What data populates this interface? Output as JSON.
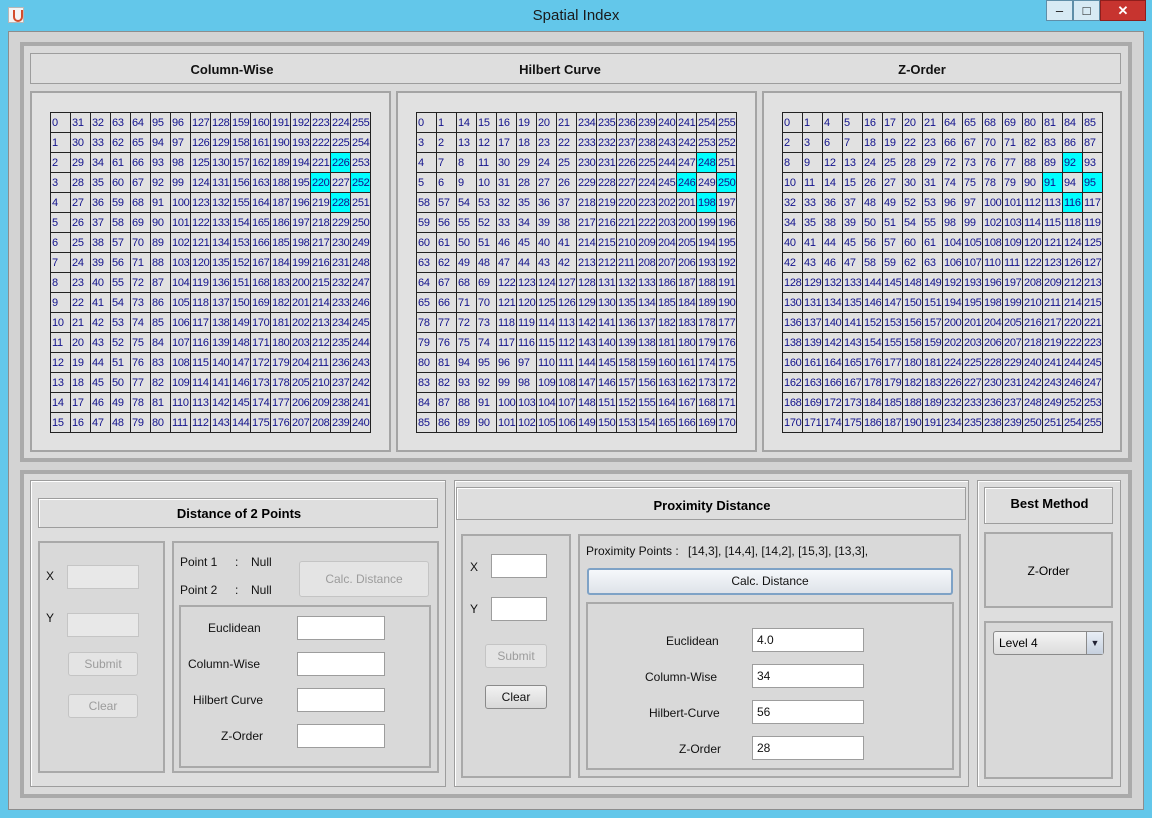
{
  "window": {
    "title": "Spatial Index"
  },
  "grid_headers": {
    "column_wise": "Column-Wise",
    "hilbert": "Hilbert Curve",
    "zorder": "Z-Order"
  },
  "grids": {
    "column_wise": [
      [
        "0",
        "31",
        "32",
        "63",
        "64",
        "95",
        "96",
        "127",
        "128",
        "159",
        "160",
        "191",
        "192",
        "223",
        "224",
        "255"
      ],
      [
        "1",
        "30",
        "33",
        "62",
        "65",
        "94",
        "97",
        "126",
        "129",
        "158",
        "161",
        "190",
        "193",
        "222",
        "225",
        "254"
      ],
      [
        "2",
        "29",
        "34",
        "61",
        "66",
        "93",
        "98",
        "125",
        "130",
        "157",
        "162",
        "189",
        "194",
        "221",
        "226",
        "253"
      ],
      [
        "3",
        "28",
        "35",
        "60",
        "67",
        "92",
        "99",
        "124",
        "131",
        "156",
        "163",
        "188",
        "195",
        "220",
        "227",
        "252"
      ],
      [
        "4",
        "27",
        "36",
        "59",
        "68",
        "91",
        "100",
        "123",
        "132",
        "155",
        "164",
        "187",
        "196",
        "219",
        "228",
        "251"
      ],
      [
        "5",
        "26",
        "37",
        "58",
        "69",
        "90",
        "101",
        "122",
        "133",
        "154",
        "165",
        "186",
        "197",
        "218",
        "229",
        "250"
      ],
      [
        "6",
        "25",
        "38",
        "57",
        "70",
        "89",
        "102",
        "121",
        "134",
        "153",
        "166",
        "185",
        "198",
        "217",
        "230",
        "249"
      ],
      [
        "7",
        "24",
        "39",
        "56",
        "71",
        "88",
        "103",
        "120",
        "135",
        "152",
        "167",
        "184",
        "199",
        "216",
        "231",
        "248"
      ],
      [
        "8",
        "23",
        "40",
        "55",
        "72",
        "87",
        "104",
        "119",
        "136",
        "151",
        "168",
        "183",
        "200",
        "215",
        "232",
        "247"
      ],
      [
        "9",
        "22",
        "41",
        "54",
        "73",
        "86",
        "105",
        "118",
        "137",
        "150",
        "169",
        "182",
        "201",
        "214",
        "233",
        "246"
      ],
      [
        "10",
        "21",
        "42",
        "53",
        "74",
        "85",
        "106",
        "117",
        "138",
        "149",
        "170",
        "181",
        "202",
        "213",
        "234",
        "245"
      ],
      [
        "11",
        "20",
        "43",
        "52",
        "75",
        "84",
        "107",
        "116",
        "139",
        "148",
        "171",
        "180",
        "203",
        "212",
        "235",
        "244"
      ],
      [
        "12",
        "19",
        "44",
        "51",
        "76",
        "83",
        "108",
        "115",
        "140",
        "147",
        "172",
        "179",
        "204",
        "211",
        "236",
        "243"
      ],
      [
        "13",
        "18",
        "45",
        "50",
        "77",
        "82",
        "109",
        "114",
        "141",
        "146",
        "173",
        "178",
        "205",
        "210",
        "237",
        "242"
      ],
      [
        "14",
        "17",
        "46",
        "49",
        "78",
        "81",
        "110",
        "113",
        "142",
        "145",
        "174",
        "177",
        "206",
        "209",
        "238",
        "241"
      ],
      [
        "15",
        "16",
        "47",
        "48",
        "79",
        "80",
        "111",
        "112",
        "143",
        "144",
        "175",
        "176",
        "207",
        "208",
        "239",
        "240"
      ]
    ],
    "hilbert": [
      [
        "0",
        "1",
        "14",
        "15",
        "16",
        "19",
        "20",
        "21",
        "234",
        "235",
        "236",
        "239",
        "240",
        "241",
        "254",
        "255"
      ],
      [
        "3",
        "2",
        "13",
        "12",
        "17",
        "18",
        "23",
        "22",
        "233",
        "232",
        "237",
        "238",
        "243",
        "242",
        "253",
        "252"
      ],
      [
        "4",
        "7",
        "8",
        "11",
        "30",
        "29",
        "24",
        "25",
        "230",
        "231",
        "226",
        "225",
        "244",
        "247",
        "248",
        "251"
      ],
      [
        "5",
        "6",
        "9",
        "10",
        "31",
        "28",
        "27",
        "26",
        "229",
        "228",
        "227",
        "224",
        "245",
        "246",
        "249",
        "250"
      ],
      [
        "58",
        "57",
        "54",
        "53",
        "32",
        "35",
        "36",
        "37",
        "218",
        "219",
        "220",
        "223",
        "202",
        "201",
        "198",
        "197"
      ],
      [
        "59",
        "56",
        "55",
        "52",
        "33",
        "34",
        "39",
        "38",
        "217",
        "216",
        "221",
        "222",
        "203",
        "200",
        "199",
        "196"
      ],
      [
        "60",
        "61",
        "50",
        "51",
        "46",
        "45",
        "40",
        "41",
        "214",
        "215",
        "210",
        "209",
        "204",
        "205",
        "194",
        "195"
      ],
      [
        "63",
        "62",
        "49",
        "48",
        "47",
        "44",
        "43",
        "42",
        "213",
        "212",
        "211",
        "208",
        "207",
        "206",
        "193",
        "192"
      ],
      [
        "64",
        "67",
        "68",
        "69",
        "122",
        "123",
        "124",
        "127",
        "128",
        "131",
        "132",
        "133",
        "186",
        "187",
        "188",
        "191"
      ],
      [
        "65",
        "66",
        "71",
        "70",
        "121",
        "120",
        "125",
        "126",
        "129",
        "130",
        "135",
        "134",
        "185",
        "184",
        "189",
        "190"
      ],
      [
        "78",
        "77",
        "72",
        "73",
        "118",
        "119",
        "114",
        "113",
        "142",
        "141",
        "136",
        "137",
        "182",
        "183",
        "178",
        "177"
      ],
      [
        "79",
        "76",
        "75",
        "74",
        "117",
        "116",
        "115",
        "112",
        "143",
        "140",
        "139",
        "138",
        "181",
        "180",
        "179",
        "176"
      ],
      [
        "80",
        "81",
        "94",
        "95",
        "96",
        "97",
        "110",
        "111",
        "144",
        "145",
        "158",
        "159",
        "160",
        "161",
        "174",
        "175"
      ],
      [
        "83",
        "82",
        "93",
        "92",
        "99",
        "98",
        "109",
        "108",
        "147",
        "146",
        "157",
        "156",
        "163",
        "162",
        "173",
        "172"
      ],
      [
        "84",
        "87",
        "88",
        "91",
        "100",
        "103",
        "104",
        "107",
        "148",
        "151",
        "152",
        "155",
        "164",
        "167",
        "168",
        "171"
      ],
      [
        "85",
        "86",
        "89",
        "90",
        "101",
        "102",
        "105",
        "106",
        "149",
        "150",
        "153",
        "154",
        "165",
        "166",
        "169",
        "170"
      ]
    ],
    "zorder": [
      [
        "0",
        "1",
        "4",
        "5",
        "16",
        "17",
        "20",
        "21",
        "64",
        "65",
        "68",
        "69",
        "80",
        "81",
        "84",
        "85"
      ],
      [
        "2",
        "3",
        "6",
        "7",
        "18",
        "19",
        "22",
        "23",
        "66",
        "67",
        "70",
        "71",
        "82",
        "83",
        "86",
        "87"
      ],
      [
        "8",
        "9",
        "12",
        "13",
        "24",
        "25",
        "28",
        "29",
        "72",
        "73",
        "76",
        "77",
        "88",
        "89",
        "92",
        "93"
      ],
      [
        "10",
        "11",
        "14",
        "15",
        "26",
        "27",
        "30",
        "31",
        "74",
        "75",
        "78",
        "79",
        "90",
        "91",
        "94",
        "95"
      ],
      [
        "32",
        "33",
        "36",
        "37",
        "48",
        "49",
        "52",
        "53",
        "96",
        "97",
        "100",
        "101",
        "112",
        "113",
        "116",
        "117"
      ],
      [
        "34",
        "35",
        "38",
        "39",
        "50",
        "51",
        "54",
        "55",
        "98",
        "99",
        "102",
        "103",
        "114",
        "115",
        "118",
        "119"
      ],
      [
        "40",
        "41",
        "44",
        "45",
        "56",
        "57",
        "60",
        "61",
        "104",
        "105",
        "108",
        "109",
        "120",
        "121",
        "124",
        "125"
      ],
      [
        "42",
        "43",
        "46",
        "47",
        "58",
        "59",
        "62",
        "63",
        "106",
        "107",
        "110",
        "111",
        "122",
        "123",
        "126",
        "127"
      ],
      [
        "128",
        "129",
        "132",
        "133",
        "144",
        "145",
        "148",
        "149",
        "192",
        "193",
        "196",
        "197",
        "208",
        "209",
        "212",
        "213"
      ],
      [
        "130",
        "131",
        "134",
        "135",
        "146",
        "147",
        "150",
        "151",
        "194",
        "195",
        "198",
        "199",
        "210",
        "211",
        "214",
        "215"
      ],
      [
        "136",
        "137",
        "140",
        "141",
        "152",
        "153",
        "156",
        "157",
        "200",
        "201",
        "204",
        "205",
        "216",
        "217",
        "220",
        "221"
      ],
      [
        "138",
        "139",
        "142",
        "143",
        "154",
        "155",
        "158",
        "159",
        "202",
        "203",
        "206",
        "207",
        "218",
        "219",
        "222",
        "223"
      ],
      [
        "160",
        "161",
        "164",
        "165",
        "176",
        "177",
        "180",
        "181",
        "224",
        "225",
        "228",
        "229",
        "240",
        "241",
        "244",
        "245"
      ],
      [
        "162",
        "163",
        "166",
        "167",
        "178",
        "179",
        "182",
        "183",
        "226",
        "227",
        "230",
        "231",
        "242",
        "243",
        "246",
        "247"
      ],
      [
        "168",
        "169",
        "172",
        "173",
        "184",
        "185",
        "188",
        "189",
        "232",
        "233",
        "236",
        "237",
        "248",
        "249",
        "252",
        "253"
      ],
      [
        "170",
        "171",
        "174",
        "175",
        "186",
        "187",
        "190",
        "191",
        "234",
        "235",
        "238",
        "239",
        "250",
        "251",
        "254",
        "255"
      ]
    ]
  },
  "highlighted_cells": [
    [
      13,
      3
    ],
    [
      14,
      4
    ],
    [
      14,
      2
    ],
    [
      15,
      3
    ],
    [
      13,
      3
    ]
  ],
  "highlight_color": "#00ffff",
  "distance_panel": {
    "title": "Distance of 2 Points",
    "x_label": "X",
    "y_label": "Y",
    "x_value": "",
    "y_value": "",
    "submit_label": "Submit",
    "clear_label": "Clear",
    "point1_label": "Point 1",
    "point1_sep": ":",
    "point1_value": "Null",
    "point2_label": "Point 2",
    "point2_sep": ":",
    "point2_value": "Null",
    "calc_label": "Calc. Distance",
    "euclidean_label": "Euclidean",
    "column_wise_label": "Column-Wise",
    "hilbert_label": "Hilbert Curve",
    "zorder_label": "Z-Order",
    "euclidean_value": "",
    "column_wise_value": "",
    "hilbert_value": "",
    "zorder_value": ""
  },
  "proximity_panel": {
    "title": "Proximity Distance",
    "x_label": "X",
    "y_label": "Y",
    "x_value": "",
    "y_value": "",
    "submit_label": "Submit",
    "clear_label": "Clear",
    "points_label": "Proximity Points  :",
    "points_value": "[14,3], [14,4], [14,2], [15,3], [13,3],",
    "calc_label": "Calc. Distance",
    "euclidean_label": "Euclidean",
    "column_wise_label": "Column-Wise",
    "hilbert_label": "Hilbert-Curve",
    "zorder_label": "Z-Order",
    "euclidean_value": "4.0",
    "column_wise_value": "34",
    "hilbert_value": "56",
    "zorder_value": "28"
  },
  "best_method": {
    "title": "Best Method",
    "value": "Z-Order",
    "level_selected": "Level 4"
  }
}
